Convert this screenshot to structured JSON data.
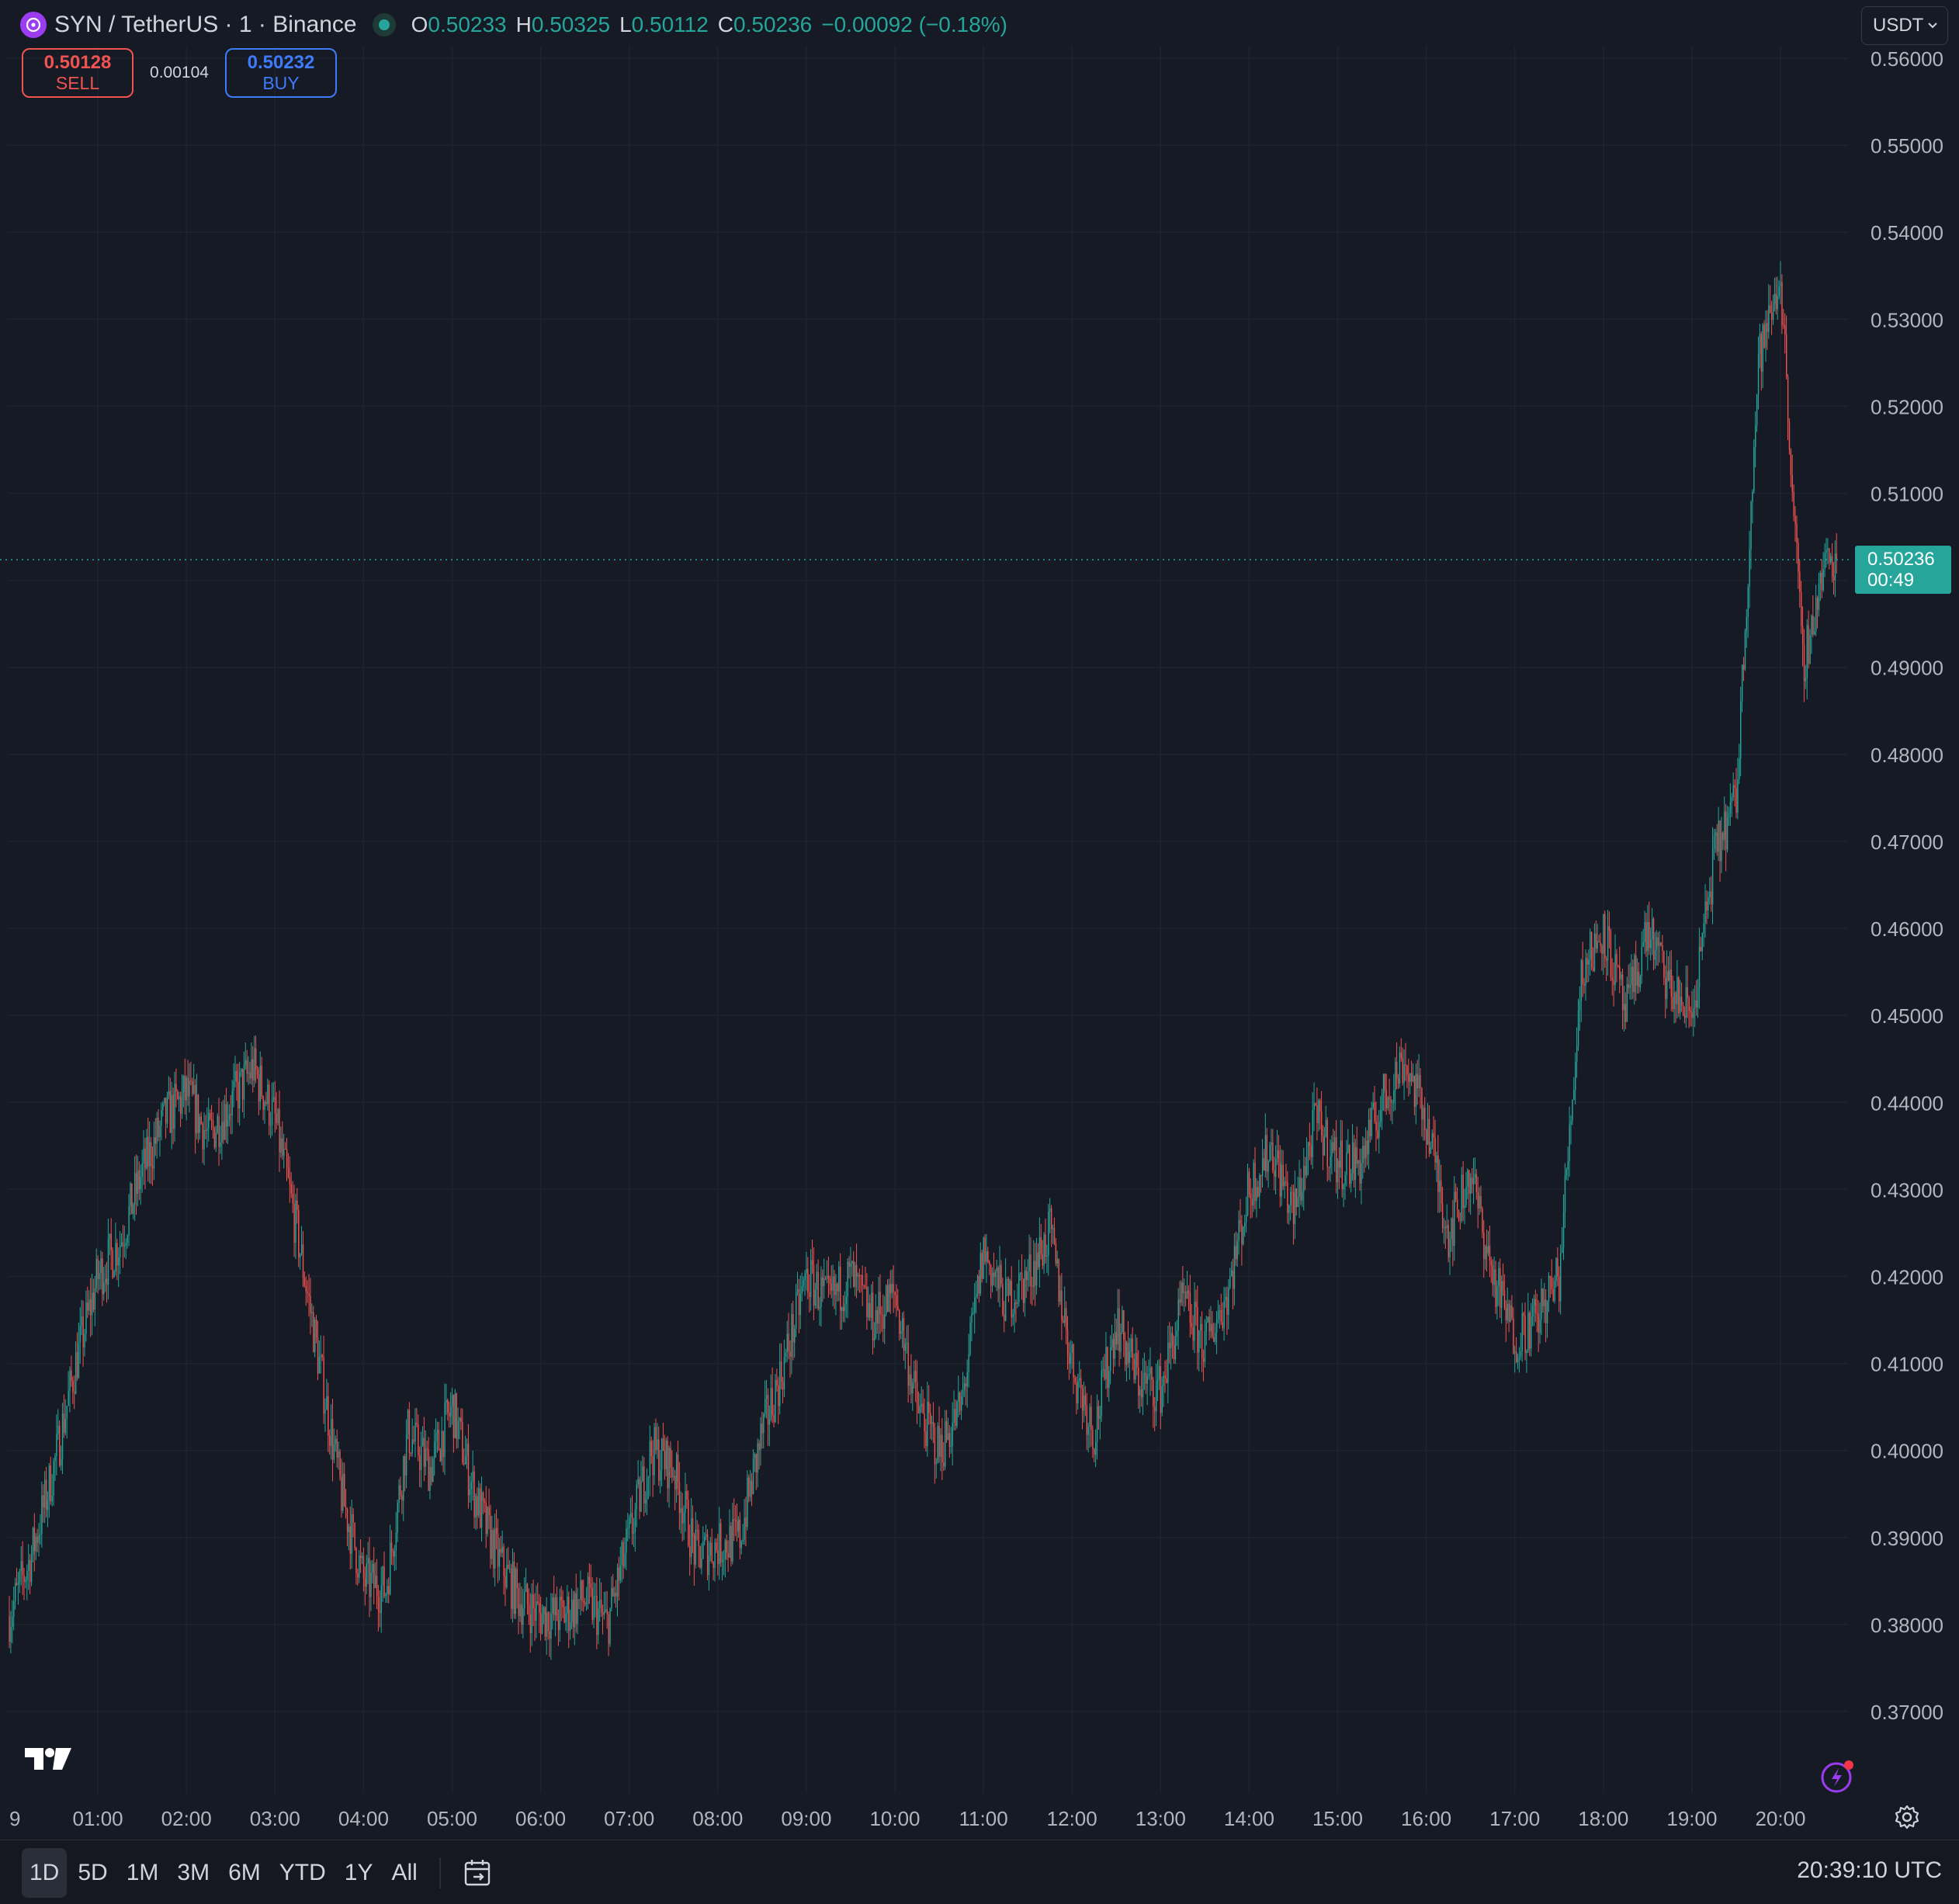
{
  "header": {
    "symbol_title": "SYN / TetherUS · 1 · Binance",
    "ohlc": {
      "open_key": "O",
      "open": "0.50233",
      "high_key": "H",
      "high": "0.50325",
      "low_key": "L",
      "low": "0.50112",
      "close_key": "C",
      "close": "0.50236",
      "change": "−0.00092 (−0.18%)"
    },
    "icons": {
      "symbol": "synapse-logo-icon",
      "status": "market-open-dot-icon"
    }
  },
  "trade": {
    "sell_price": "0.50128",
    "sell_label": "SELL",
    "spread": "0.00104",
    "buy_price": "0.50232",
    "buy_label": "BUY"
  },
  "currency": {
    "label": "USDT",
    "icon": "chevron-down-icon"
  },
  "price_axis": {
    "ticks": [
      "0.56000",
      "0.55000",
      "0.54000",
      "0.53000",
      "0.52000",
      "0.51000",
      "0.49000",
      "0.48000",
      "0.47000",
      "0.46000",
      "0.45000",
      "0.44000",
      "0.43000",
      "0.42000",
      "0.41000",
      "0.40000",
      "0.39000",
      "0.38000",
      "0.37000"
    ],
    "last_price": "0.50236",
    "countdown": "00:49"
  },
  "time_axis": {
    "ticks": [
      "9",
      "01:00",
      "02:00",
      "03:00",
      "04:00",
      "05:00",
      "06:00",
      "07:00",
      "08:00",
      "09:00",
      "10:00",
      "11:00",
      "12:00",
      "13:00",
      "14:00",
      "15:00",
      "16:00",
      "17:00",
      "18:00",
      "19:00",
      "20:00"
    ]
  },
  "range_tabs": [
    "1D",
    "5D",
    "1M",
    "3M",
    "6M",
    "YTD",
    "1Y",
    "All"
  ],
  "active_range": "1D",
  "clock": "20:39:10 UTC",
  "colors": {
    "up": "#26a69a",
    "down": "#ef5350",
    "background": "#161a25",
    "grid": "#1f2330",
    "buy": "#3e7bfa",
    "accent": "#9b3cf0"
  },
  "chart_data": {
    "type": "candlestick",
    "interval": "1 minute",
    "x_unit": "hour of day (UTC)",
    "ylim": [
      0.36,
      0.56
    ],
    "grid": true,
    "last_price": 0.50236,
    "x": [
      0.0,
      0.25,
      0.5,
      0.75,
      1.0,
      1.25,
      1.5,
      1.75,
      2.0,
      2.25,
      2.5,
      2.75,
      3.0,
      3.25,
      3.5,
      3.75,
      4.0,
      4.25,
      4.5,
      4.75,
      5.0,
      5.25,
      5.5,
      5.75,
      6.0,
      6.25,
      6.5,
      6.75,
      7.0,
      7.25,
      7.5,
      7.75,
      8.0,
      8.25,
      8.5,
      8.75,
      9.0,
      9.25,
      9.5,
      9.75,
      10.0,
      10.25,
      10.5,
      10.75,
      11.0,
      11.25,
      11.5,
      11.75,
      12.0,
      12.25,
      12.5,
      12.75,
      13.0,
      13.25,
      13.5,
      13.75,
      14.0,
      14.25,
      14.5,
      14.75,
      15.0,
      15.25,
      15.5,
      15.75,
      16.0,
      16.25,
      16.5,
      16.75,
      17.0,
      17.25,
      17.5,
      17.75,
      18.0,
      18.25,
      18.5,
      18.75,
      19.0,
      19.25,
      19.5,
      19.75,
      20.0,
      20.25,
      20.5
    ],
    "y": [
      0.381,
      0.388,
      0.398,
      0.41,
      0.42,
      0.424,
      0.432,
      0.438,
      0.441,
      0.436,
      0.44,
      0.444,
      0.438,
      0.425,
      0.41,
      0.395,
      0.385,
      0.384,
      0.402,
      0.398,
      0.405,
      0.395,
      0.388,
      0.383,
      0.381,
      0.381,
      0.383,
      0.38,
      0.39,
      0.4,
      0.398,
      0.388,
      0.389,
      0.39,
      0.402,
      0.41,
      0.42,
      0.417,
      0.42,
      0.415,
      0.418,
      0.405,
      0.4,
      0.405,
      0.423,
      0.417,
      0.42,
      0.425,
      0.41,
      0.402,
      0.415,
      0.408,
      0.407,
      0.417,
      0.412,
      0.418,
      0.43,
      0.435,
      0.427,
      0.438,
      0.433,
      0.433,
      0.44,
      0.445,
      0.438,
      0.425,
      0.432,
      0.42,
      0.413,
      0.415,
      0.42,
      0.455,
      0.46,
      0.45,
      0.46,
      0.453,
      0.45,
      0.468,
      0.475,
      0.525,
      0.535,
      0.49,
      0.502
    ]
  }
}
